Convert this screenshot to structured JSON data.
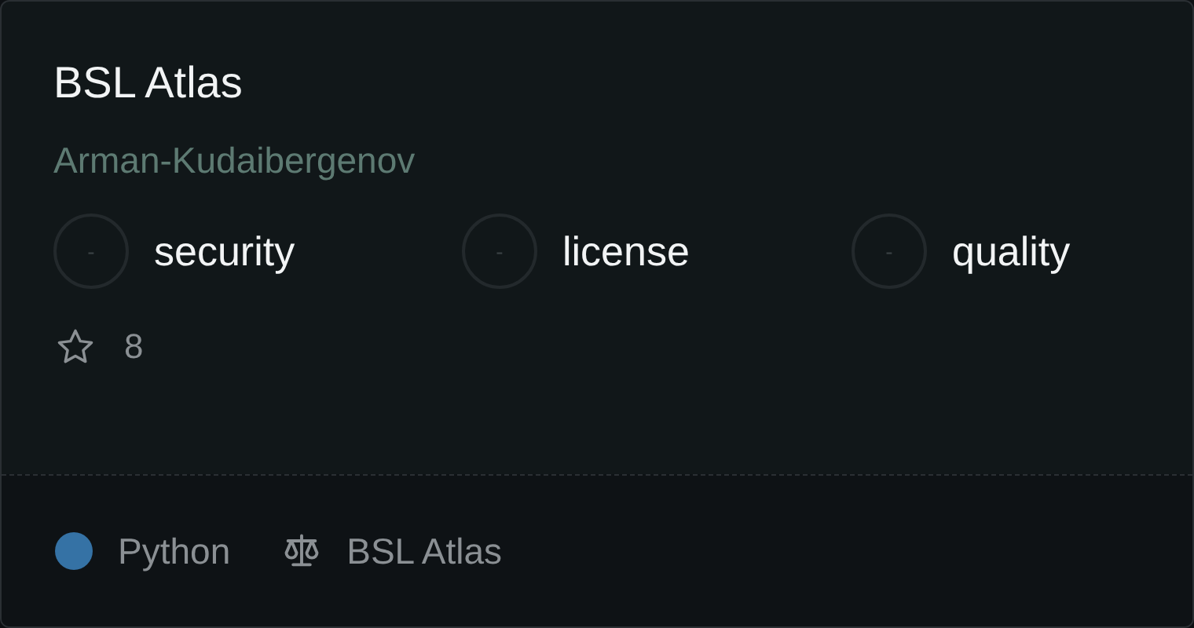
{
  "repo": {
    "name": "BSL Atlas",
    "owner": "Arman-Kudaibergenov"
  },
  "scores": [
    {
      "score": "-",
      "label": "security"
    },
    {
      "score": "-",
      "label": "license"
    },
    {
      "score": "-",
      "label": "quality"
    }
  ],
  "stars": "8",
  "footer": {
    "language": {
      "name": "Python",
      "color": "#3572a5"
    },
    "license": "BSL Atlas"
  }
}
